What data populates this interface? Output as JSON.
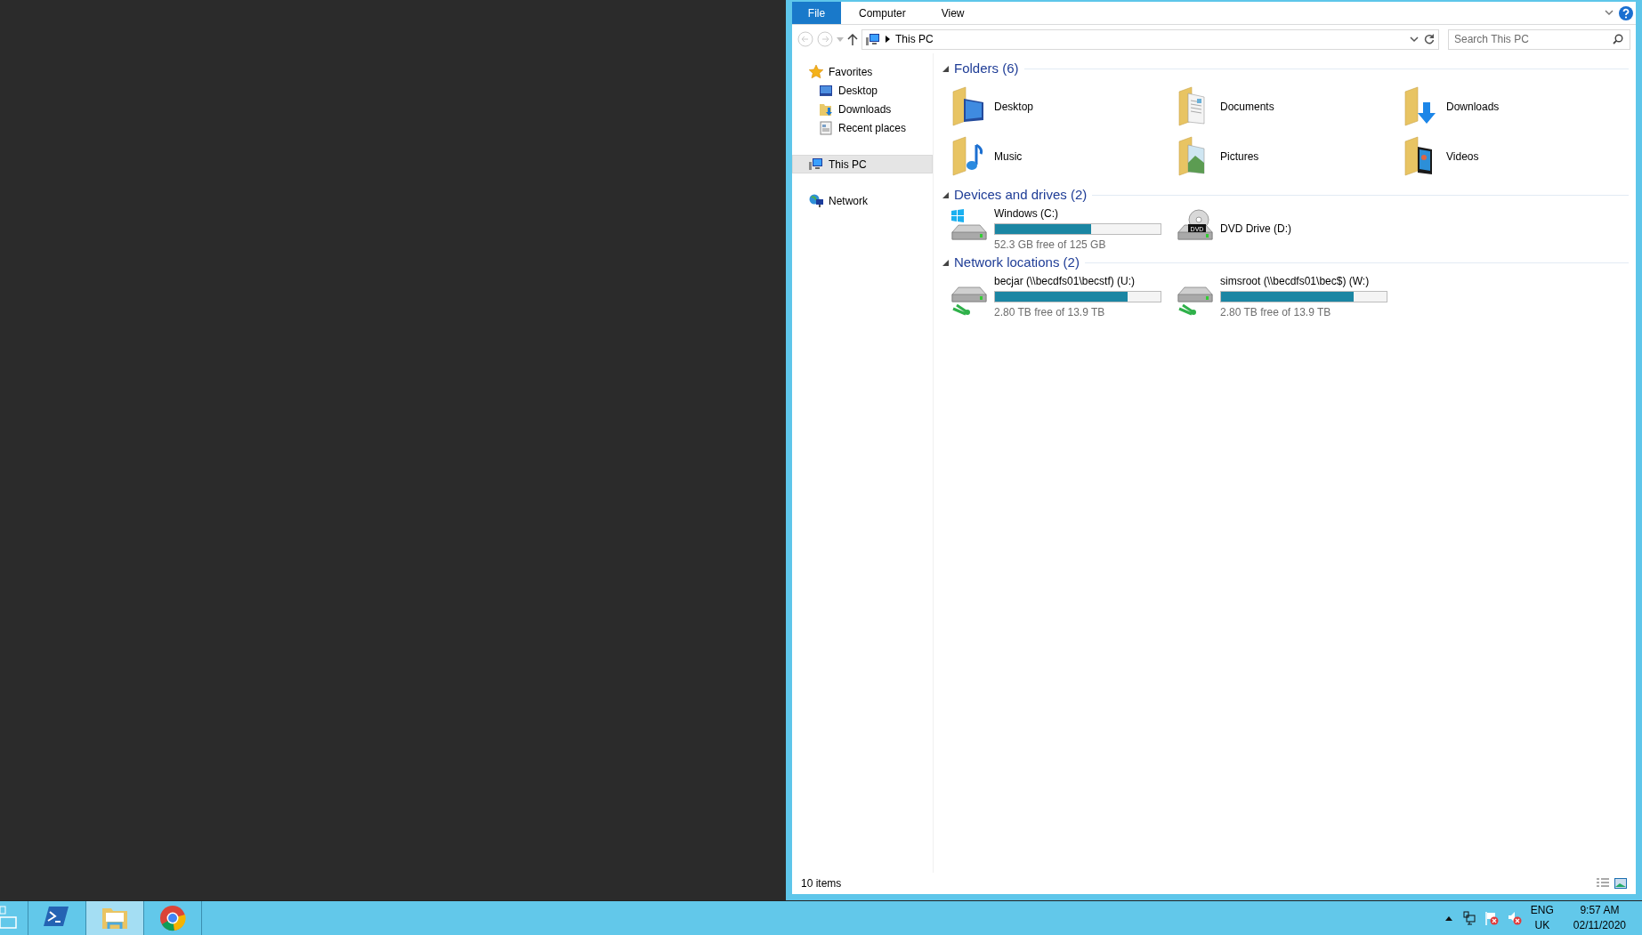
{
  "ribbon": {
    "file_menu": "File",
    "tabs": [
      "Computer",
      "View"
    ]
  },
  "address": {
    "path": "This PC"
  },
  "search": {
    "placeholder": "Search This PC"
  },
  "nav": [
    {
      "label": "Favorites",
      "kind": "star",
      "selected": false,
      "children": [
        {
          "label": "Desktop",
          "kind": "desktop",
          "selected": false
        },
        {
          "label": "Downloads",
          "kind": "downloads",
          "selected": false
        },
        {
          "label": "Recent places",
          "kind": "recent",
          "selected": false
        }
      ]
    },
    {
      "label": "This PC",
      "kind": "pc",
      "selected": true
    },
    {
      "label": "Network",
      "kind": "network",
      "selected": false
    }
  ],
  "sections": [
    {
      "title": "Folders (6)",
      "expanded": true,
      "items": [
        {
          "kind": "desktop",
          "name": "Desktop"
        },
        {
          "kind": "documents",
          "name": "Documents"
        },
        {
          "kind": "downloads",
          "name": "Downloads"
        },
        {
          "kind": "music",
          "name": "Music"
        },
        {
          "kind": "pictures",
          "name": "Pictures"
        },
        {
          "kind": "videos",
          "name": "Videos"
        }
      ]
    },
    {
      "title": "Devices and drives (2)",
      "expanded": true,
      "items": [
        {
          "kind": "drive",
          "name": "Windows (C:)",
          "level": 0.58,
          "free": "52.3 GB free of 125 GB"
        },
        {
          "kind": "dvd",
          "name": "DVD Drive (D:)",
          "icon_label": "DVD"
        }
      ]
    },
    {
      "title": "Network locations (2)",
      "expanded": true,
      "items": [
        {
          "kind": "netdrive",
          "name": "becjar (\\\\becdfs01\\becstf) (U:)",
          "level": 0.8,
          "free": "2.80 TB free of 13.9 TB"
        },
        {
          "kind": "netdrive",
          "name": "simsroot (\\\\becdfs01\\bec$) (W:)",
          "level": 0.8,
          "free": "2.80 TB free of 13.9 TB"
        }
      ]
    }
  ],
  "status_bar": {
    "count": "10 items"
  },
  "taskbar": {
    "apps": [
      {
        "kind": "server",
        "selected": false
      },
      {
        "kind": "powershell",
        "selected": false
      },
      {
        "kind": "explorer",
        "selected": true
      },
      {
        "kind": "chrome",
        "selected": false
      }
    ],
    "language": [
      "ENG",
      "UK"
    ],
    "time": "9:57 AM",
    "date": "02/11/2020"
  }
}
